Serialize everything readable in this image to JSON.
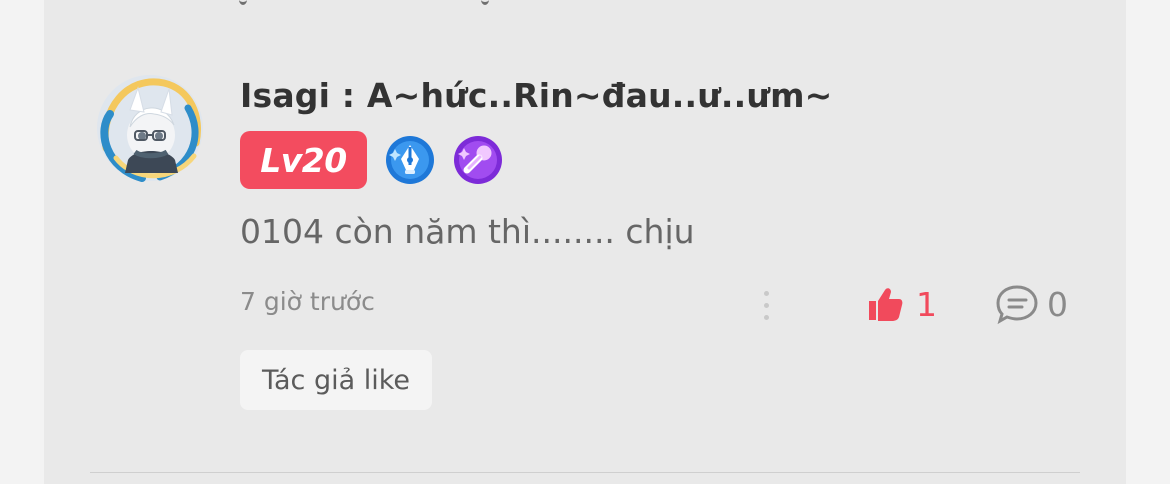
{
  "comment_card": {
    "username": "Isagi : A~hức..Rin~đau..ư..ưm~",
    "avatar_icon": "anime-avatar-icon",
    "level": "Lv20",
    "badges": [
      "pen-badge-icon",
      "microphone-badge-icon"
    ],
    "text": "0104 còn năm thì........ chịu",
    "time": "7 giờ trước",
    "more_icon": "more-vertical-icon",
    "likes": "1",
    "replies": "0",
    "author_like_label": "Tác giả like",
    "colors": {
      "accent": "#f34c5f",
      "pen_badge": "#1e78d8",
      "mic_badge": "#7d2bd8"
    }
  }
}
